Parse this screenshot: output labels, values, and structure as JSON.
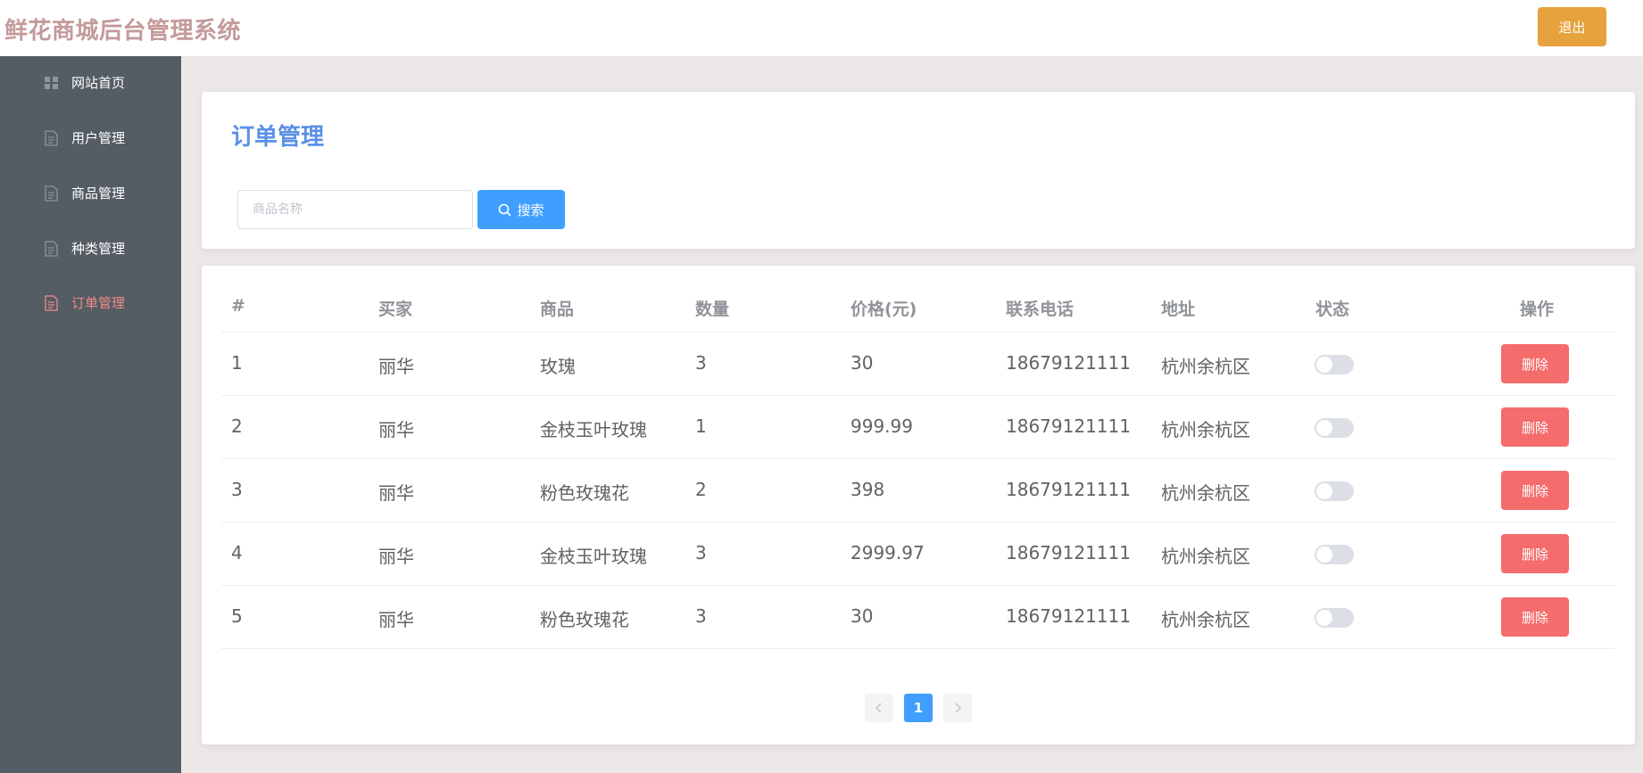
{
  "header": {
    "brand": "鲜花商城后台管理系统",
    "logout_label": "退出"
  },
  "sidebar": {
    "items": [
      {
        "label": "网站首页",
        "icon": "grid-icon",
        "active": false
      },
      {
        "label": "用户管理",
        "icon": "document-icon",
        "active": false
      },
      {
        "label": "商品管理",
        "icon": "document-icon",
        "active": false
      },
      {
        "label": "种类管理",
        "icon": "document-icon",
        "active": false
      },
      {
        "label": "订单管理",
        "icon": "document-icon",
        "active": true
      }
    ]
  },
  "page": {
    "title": "订单管理",
    "search": {
      "placeholder": "商品名称",
      "value": "",
      "button_label": "搜索"
    }
  },
  "table": {
    "columns": [
      "#",
      "买家",
      "商品",
      "数量",
      "价格(元)",
      "联系电话",
      "地址",
      "状态",
      "操作"
    ],
    "rows": [
      {
        "id": "1",
        "buyer": "丽华",
        "product": "玫瑰",
        "qty": "3",
        "price": "30",
        "phone": "18679121111",
        "address": "杭州余杭区",
        "status": false,
        "action": "删除"
      },
      {
        "id": "2",
        "buyer": "丽华",
        "product": "金枝玉叶玫瑰",
        "qty": "1",
        "price": "999.99",
        "phone": "18679121111",
        "address": "杭州余杭区",
        "status": false,
        "action": "删除"
      },
      {
        "id": "3",
        "buyer": "丽华",
        "product": "粉色玫瑰花",
        "qty": "2",
        "price": "398",
        "phone": "18679121111",
        "address": "杭州余杭区",
        "status": false,
        "action": "删除"
      },
      {
        "id": "4",
        "buyer": "丽华",
        "product": "金枝玉叶玫瑰",
        "qty": "3",
        "price": "2999.97",
        "phone": "18679121111",
        "address": "杭州余杭区",
        "status": false,
        "action": "删除"
      },
      {
        "id": "5",
        "buyer": "丽华",
        "product": "粉色玫瑰花",
        "qty": "3",
        "price": "30",
        "phone": "18679121111",
        "address": "杭州余杭区",
        "status": false,
        "action": "删除"
      }
    ]
  },
  "pagination": {
    "current_page": "1",
    "prev_icon": "chevron-left-icon",
    "next_icon": "chevron-right-icon"
  },
  "colors": {
    "brand": "#c49a9a",
    "sidebar_bg": "#545c64",
    "active_nav": "#f18a8a",
    "title": "#5b8fe6",
    "primary": "#409eff",
    "danger": "#f56c6c",
    "warning": "#e6a23c"
  }
}
